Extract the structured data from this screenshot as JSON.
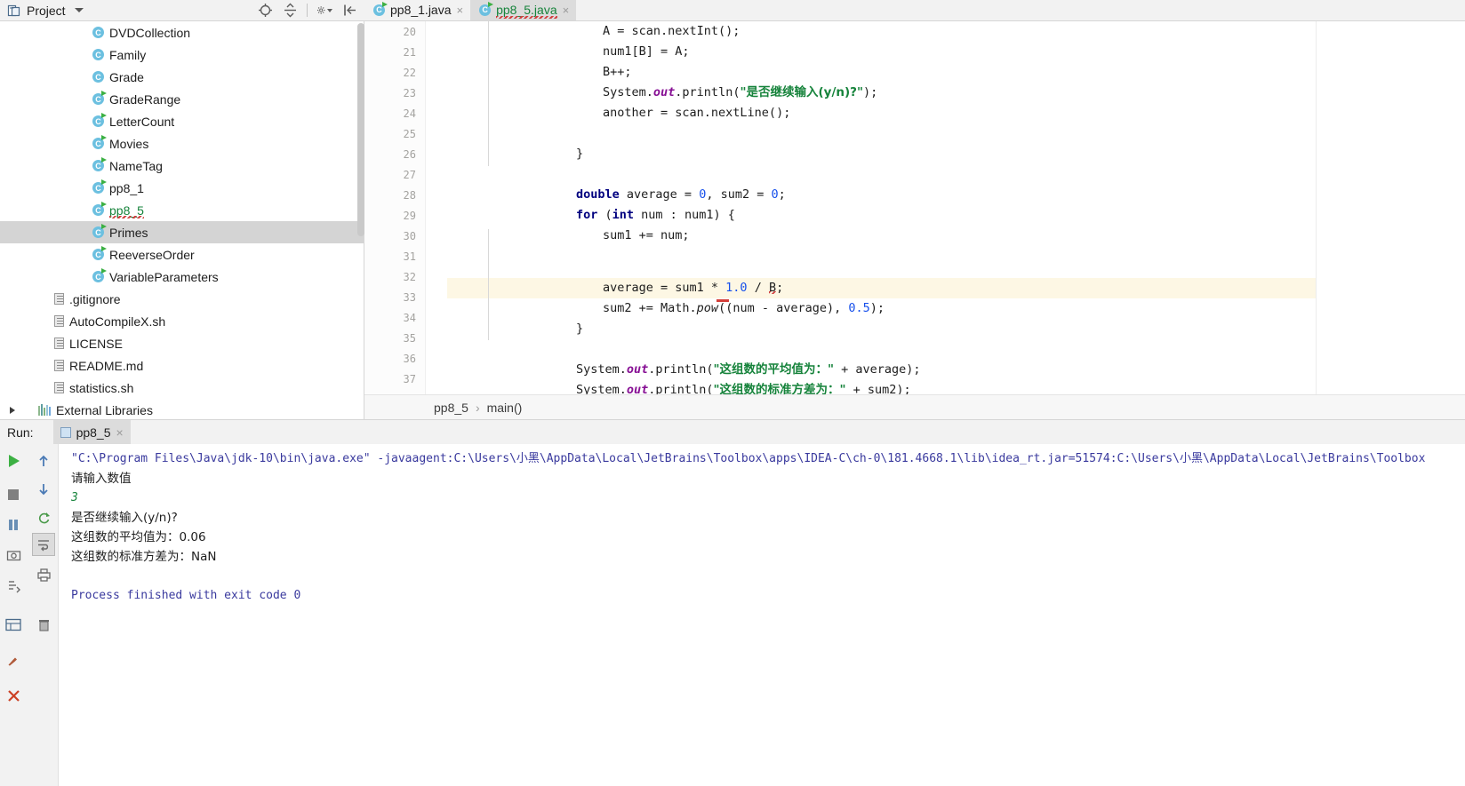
{
  "project_toolbar": {
    "title": "Project",
    "icons": [
      "locate-icon",
      "collapse-all-icon",
      "settings-gear-icon",
      "hide-panel-icon"
    ]
  },
  "tabs": [
    {
      "label": "pp8_1.java",
      "active": false,
      "modified": false,
      "close": "×",
      "icon": "java-class-icon"
    },
    {
      "label": "pp8_5.java",
      "active": true,
      "modified": true,
      "close": "×",
      "icon": "java-class-runnable-icon"
    }
  ],
  "tree": {
    "items": [
      {
        "label": "DVDCollection",
        "icon": "class-icon",
        "runnable": false,
        "indent": 98,
        "selected": false,
        "green": false
      },
      {
        "label": "Family",
        "icon": "class-icon",
        "runnable": false,
        "indent": 98,
        "selected": false,
        "green": false
      },
      {
        "label": "Grade",
        "icon": "class-icon",
        "runnable": false,
        "indent": 98,
        "selected": false,
        "green": false
      },
      {
        "label": "GradeRange",
        "icon": "class-icon",
        "runnable": true,
        "indent": 98,
        "selected": false,
        "green": false
      },
      {
        "label": "LetterCount",
        "icon": "class-icon",
        "runnable": true,
        "indent": 98,
        "selected": false,
        "green": false
      },
      {
        "label": "Movies",
        "icon": "class-icon",
        "runnable": true,
        "indent": 98,
        "selected": false,
        "green": false
      },
      {
        "label": "NameTag",
        "icon": "class-icon",
        "runnable": true,
        "indent": 98,
        "selected": false,
        "green": false
      },
      {
        "label": "pp8_1",
        "icon": "class-icon",
        "runnable": true,
        "indent": 98,
        "selected": false,
        "green": false
      },
      {
        "label": "pp8_5",
        "icon": "class-icon",
        "runnable": true,
        "indent": 98,
        "selected": false,
        "green": true
      },
      {
        "label": "Primes",
        "icon": "class-icon",
        "runnable": true,
        "indent": 98,
        "selected": true,
        "green": false
      },
      {
        "label": "ReeverseOrder",
        "icon": "class-icon",
        "runnable": true,
        "indent": 98,
        "selected": false,
        "green": false
      },
      {
        "label": "VariableParameters",
        "icon": "class-icon",
        "runnable": true,
        "indent": 98,
        "selected": false,
        "green": false
      },
      {
        "label": ".gitignore",
        "icon": "file-icon",
        "runnable": false,
        "indent": 55,
        "selected": false,
        "green": false
      },
      {
        "label": "AutoCompileX.sh",
        "icon": "file-icon",
        "runnable": false,
        "indent": 55,
        "selected": false,
        "green": false
      },
      {
        "label": "LICENSE",
        "icon": "file-icon",
        "runnable": false,
        "indent": 55,
        "selected": false,
        "green": false
      },
      {
        "label": "README.md",
        "icon": "file-icon",
        "runnable": false,
        "indent": 55,
        "selected": false,
        "green": false
      },
      {
        "label": "statistics.sh",
        "icon": "file-icon",
        "runnable": false,
        "indent": 55,
        "selected": false,
        "green": false
      }
    ],
    "external_libraries": {
      "label": "External Libraries",
      "icon": "library-icon",
      "expander": "chevron-right-icon"
    }
  },
  "editor": {
    "first_line": 20,
    "lines": [
      {
        "n": 20,
        "indent": 168
      },
      {
        "n": 21,
        "indent": 168
      },
      {
        "n": 22,
        "indent": 168
      },
      {
        "n": 23,
        "indent": 168
      },
      {
        "n": 24,
        "indent": 168
      },
      {
        "n": 25,
        "indent": 0
      },
      {
        "n": 26,
        "indent": 138
      },
      {
        "n": 27,
        "indent": 0
      },
      {
        "n": 28,
        "indent": 138
      },
      {
        "n": 29,
        "indent": 138
      },
      {
        "n": 30,
        "indent": 168
      },
      {
        "n": 31,
        "indent": 0
      },
      {
        "n": 32,
        "indent": 168
      },
      {
        "n": 33,
        "indent": 168
      },
      {
        "n": 34,
        "indent": 138
      },
      {
        "n": 35,
        "indent": 0
      },
      {
        "n": 36,
        "indent": 138
      },
      {
        "n": 37,
        "indent": 138
      }
    ],
    "code_text": {
      "l20": "A = scan.nextInt();",
      "l21": "num1[B] = A;",
      "l22": "B++;",
      "l23_pre": "System.",
      "l23_out": "out",
      "l23_mid": ".println(",
      "l23_str": "\"是否继续输入(y/n)?\"",
      "l23_end": ");",
      "l24": "another = scan.nextLine();",
      "l26": "}",
      "l28_kw": "double",
      "l28_a": " average = ",
      "l28_n1": "0",
      "l28_b": ", sum2 = ",
      "l28_n2": "0",
      "l28_c": ";",
      "l29_for": "for",
      "l29_a": " (",
      "l29_int": "int",
      "l29_b": " num : num1) {",
      "l30": "sum1 += num;",
      "l32_a": "average = sum1 * ",
      "l32_n": "1.0",
      "l32_b": " / ",
      "l32_err": "B",
      "l32_c": ";",
      "l33_a": "sum2 += Math.",
      "l33_pow": "pow",
      "l33_b": "((num - average), ",
      "l33_n": "0.5",
      "l33_c": ");",
      "l34": "}",
      "l36_pre": "System.",
      "l36_out": "out",
      "l36_mid": ".println(",
      "l36_str": "\"这组数的平均值为：\"",
      "l36_end": " + average);",
      "l37_pre": "System.",
      "l37_out": "out",
      "l37_mid": ".println(",
      "l37_str": "\"这组数的标准方差为：\"",
      "l37_end": " + sum2);"
    }
  },
  "breadcrumb": {
    "file": "pp8_5",
    "separator": "›",
    "method": "main()"
  },
  "run_window": {
    "label": "Run:",
    "tab_label": "pp8_5",
    "tab_close": "×",
    "left_buttons": [
      "run-icon",
      "up-arrow-icon",
      "stop-icon",
      "down-arrow-icon",
      "pause-icon",
      "rerun-tests-icon",
      "camera-icon",
      "soft-wrap-icon",
      "scroll-to-end-icon",
      "print-icon",
      "toggle-tasks-icon",
      "trash-icon",
      "pin-icon",
      "close-icon"
    ],
    "console": {
      "command": "\"C:\\Program Files\\Java\\jdk-10\\bin\\java.exe\" -javaagent:C:\\Users\\小黑\\AppData\\Local\\JetBrains\\Toolbox\\apps\\IDEA-C\\ch-0\\181.4668.1\\lib\\idea_rt.jar=51574:C:\\Users\\小黑\\AppData\\Local\\JetBrains\\Toolbox",
      "prompt": "请输入数值",
      "user_input": "3",
      "question": "是否继续输入(y/n)?",
      "average_line": "这组数的平均值为：0.06",
      "stddev_line": "这组数的标准方差为：NaN",
      "exit_line": "Process finished with exit code 0"
    }
  },
  "colors": {
    "accent_green": "#16833b",
    "keyword_blue": "#00007f",
    "number_blue": "#1750eb",
    "field_purple": "#871094",
    "error_red": "#d43f3a",
    "selection_gray": "#d4d4d4",
    "caret_line": "#fdf7e4"
  }
}
